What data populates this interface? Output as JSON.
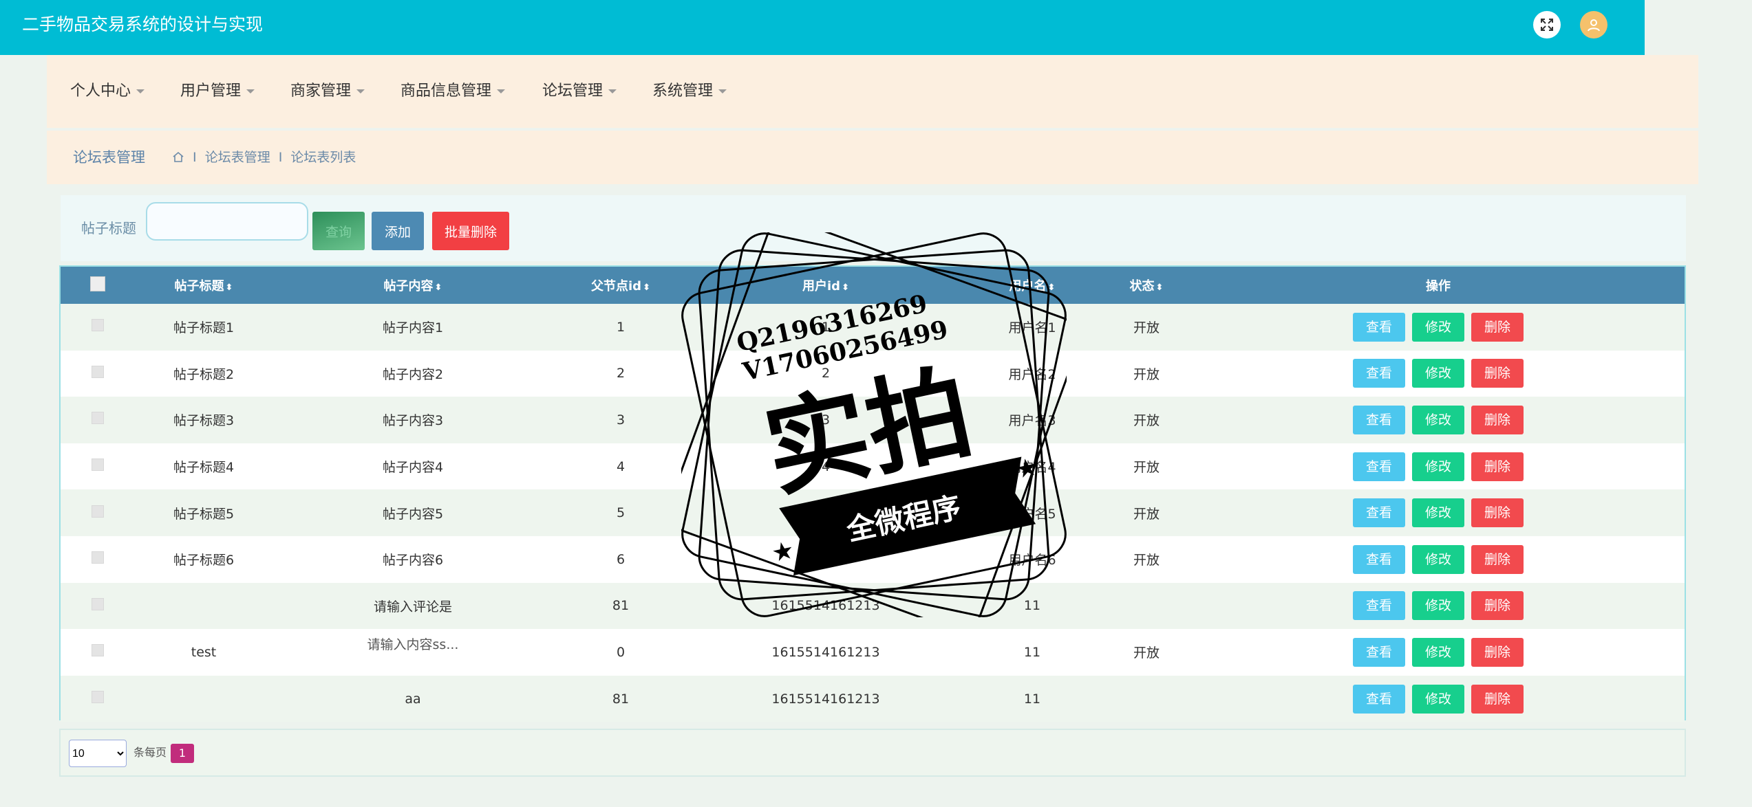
{
  "header": {
    "title": "二手物品交易系统的设计与实现",
    "icons": [
      "fullscreen-icon",
      "user-avatar-icon"
    ]
  },
  "nav": {
    "items": [
      "个人中心",
      "用户管理",
      "商家管理",
      "商品信息管理",
      "论坛管理",
      "系统管理"
    ]
  },
  "breadcrumb": {
    "title": "论坛表管理",
    "trail": [
      "论坛表管理",
      "论坛表列表"
    ],
    "separator": "I"
  },
  "search": {
    "label": "帖子标题",
    "value": "",
    "search_button": "查询",
    "add_button": "添加",
    "batch_delete_button": "批量删除"
  },
  "table": {
    "columns": [
      "帖子标题",
      "帖子内容",
      "父节点id",
      "用户id",
      "用户名",
      "状态",
      "操作"
    ],
    "sort_glyph": "⬍",
    "rows": [
      {
        "title": "帖子标题1",
        "content": "帖子内容1",
        "parent_id": "1",
        "user_id": "1",
        "username": "用户名1",
        "status": "开放"
      },
      {
        "title": "帖子标题2",
        "content": "帖子内容2",
        "parent_id": "2",
        "user_id": "2",
        "username": "用户名2",
        "status": "开放"
      },
      {
        "title": "帖子标题3",
        "content": "帖子内容3",
        "parent_id": "3",
        "user_id": "3",
        "username": "用户名3",
        "status": "开放"
      },
      {
        "title": "帖子标题4",
        "content": "帖子内容4",
        "parent_id": "4",
        "user_id": "4",
        "username": "用户名4",
        "status": "开放"
      },
      {
        "title": "帖子标题5",
        "content": "帖子内容5",
        "parent_id": "5",
        "user_id": "5",
        "username": "用户名5",
        "status": "开放"
      },
      {
        "title": "帖子标题6",
        "content": "帖子内容6",
        "parent_id": "6",
        "user_id": "6",
        "username": "用户名6",
        "status": "开放"
      },
      {
        "title": "",
        "content": "请输入评论是",
        "parent_id": "81",
        "user_id": "1615514161213",
        "username": "11",
        "status": ""
      },
      {
        "title": "test",
        "content": "请输入内容ss...",
        "parent_id": "0",
        "user_id": "1615514161213",
        "username": "11",
        "status": "开放"
      },
      {
        "title": "",
        "content": "aa",
        "parent_id": "81",
        "user_id": "1615514161213",
        "username": "11",
        "status": ""
      }
    ],
    "actions": {
      "view": "查看",
      "edit": "修改",
      "delete": "删除"
    }
  },
  "pagination": {
    "page_size": "10",
    "page_size_options": [
      "10"
    ],
    "per_page_label": "条每页",
    "current_page": "1"
  },
  "watermark": {
    "line1": "Q2196316269",
    "line2": "V17060256499",
    "big_text": "实拍",
    "ribbon_text": "全微程序"
  },
  "colors": {
    "header_bg": "#00bcd4",
    "nav_bg": "#fcefe0",
    "table_header_bg": "#4a88ae",
    "view_btn": "#4cc7ee",
    "edit_btn": "#17cf8d",
    "delete_btn": "#f24a4e",
    "page_active": "#c12c7c"
  }
}
